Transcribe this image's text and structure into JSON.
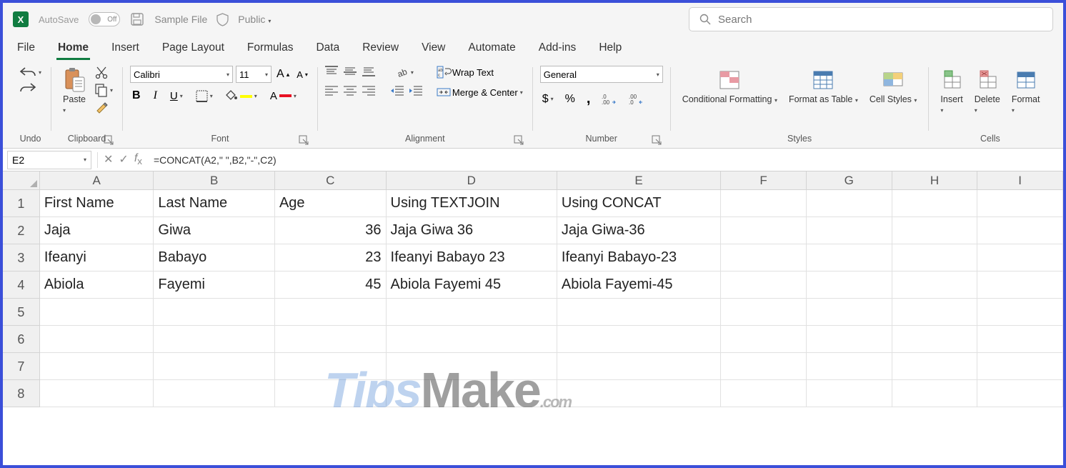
{
  "titlebar": {
    "logo_letter": "X",
    "autosave_label": "AutoSave",
    "autosave_state": "Off",
    "filename": "Sample File",
    "privacy": "Public",
    "search_placeholder": "Search"
  },
  "tabs": [
    "File",
    "Home",
    "Insert",
    "Page Layout",
    "Formulas",
    "Data",
    "Review",
    "View",
    "Automate",
    "Add-ins",
    "Help"
  ],
  "active_tab": "Home",
  "ribbon": {
    "undo": {
      "label": "Undo"
    },
    "clipboard": {
      "label": "Clipboard",
      "paste": "Paste"
    },
    "font": {
      "label": "Font",
      "name": "Calibri",
      "size": "11",
      "bold": "B",
      "italic": "I",
      "underline": "U",
      "grow": "A",
      "shrink": "A"
    },
    "alignment": {
      "label": "Alignment",
      "wrap": "Wrap Text",
      "merge": "Merge & Center"
    },
    "number": {
      "label": "Number",
      "format": "General",
      "currency": "$",
      "percent": "%",
      "comma": ",",
      "inc": ".00",
      "dec": ".00"
    },
    "styles": {
      "label": "Styles",
      "cond": "Conditional Formatting",
      "table": "Format as Table",
      "cell": "Cell Styles"
    },
    "cells": {
      "label": "Cells",
      "insert": "Insert",
      "delete": "Delete",
      "format": "Format"
    }
  },
  "formula_bar": {
    "name_box": "E2",
    "formula": "=CONCAT(A2,\" \",B2,\"-\",C2)"
  },
  "columns": [
    "A",
    "B",
    "C",
    "D",
    "E",
    "F",
    "G",
    "H",
    "I"
  ],
  "col_widths": [
    "wA",
    "wB",
    "wC",
    "wD",
    "wE",
    "wF",
    "wG",
    "wH",
    "wI"
  ],
  "row_numbers": [
    1,
    2,
    3,
    4,
    5,
    6,
    7,
    8
  ],
  "sheet": {
    "headers": {
      "A": "First Name",
      "B": "Last Name",
      "C": "Age",
      "D": "Using TEXTJOIN",
      "E": "Using CONCAT"
    },
    "rows": [
      {
        "A": "Jaja",
        "B": "Giwa",
        "C": "36",
        "D": "Jaja Giwa 36",
        "E": "Jaja Giwa-36"
      },
      {
        "A": "Ifeanyi",
        "B": "Babayo",
        "C": "23",
        "D": "Ifeanyi Babayo 23",
        "E": "Ifeanyi Babayo-23"
      },
      {
        "A": "Abiola",
        "B": "Fayemi",
        "C": "45",
        "D": "Abiola Fayemi 45",
        "E": "Abiola Fayemi-45"
      }
    ]
  },
  "watermark": {
    "t1": "Tips",
    "t2": "Make",
    "t3": ".com"
  }
}
